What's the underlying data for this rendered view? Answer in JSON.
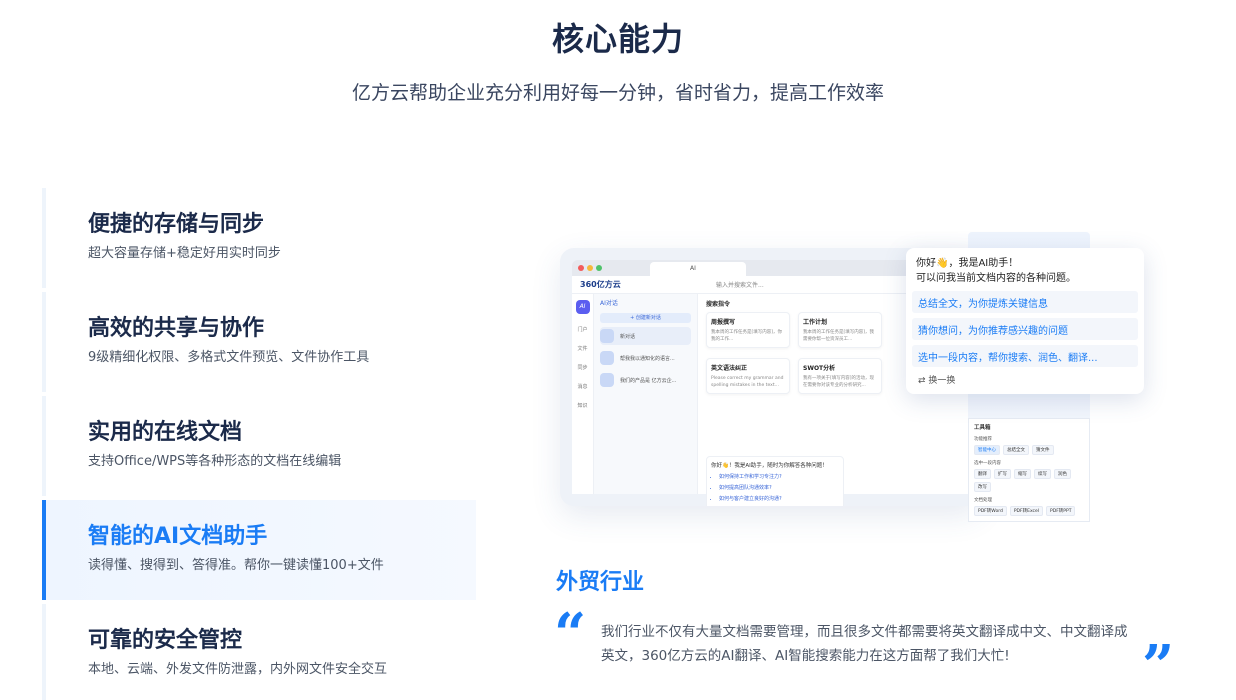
{
  "header": {
    "title": "核心能力",
    "subtitle": "亿方云帮助企业充分利用好每一分钟，省时省力，提高工作效率"
  },
  "features": [
    {
      "title": "便捷的存储与同步",
      "desc": "超大容量存储+稳定好用实时同步",
      "active": false
    },
    {
      "title": "高效的共享与协作",
      "desc": "9级精细化权限、多格式文件预览、文件协作工具",
      "active": false
    },
    {
      "title": "实用的在线文档",
      "desc": "支持Office/WPS等各种形态的文档在线编辑",
      "active": false
    },
    {
      "title": "智能的AI文档助手",
      "desc": "读得懂、搜得到、答得准。帮你一键读懂100+文件",
      "active": true
    },
    {
      "title": "可靠的安全管控",
      "desc": "本地、云端、外发文件防泄露，内外网文件安全交互",
      "active": false
    }
  ],
  "mockup": {
    "tab_label": "AI",
    "logo": "360亿方云",
    "search_placeholder": "输入并搜索文件...",
    "side_nav": [
      "门户",
      "文件",
      "同步",
      "消息",
      "知识"
    ],
    "ai_badge": "AI",
    "list_header": "AI对话",
    "new_chat": "+ 创建新对话",
    "chats": [
      "新对话",
      "帮我我以通知化的语言...",
      "我们的产品是 亿方云企..."
    ],
    "main_header": "搜索指令",
    "cards": [
      {
        "title": "周报撰写",
        "desc": "我本周的工作任务是[填写内容]，你我的工作..."
      },
      {
        "title": "工作计划",
        "desc": "我本周的工作任务是[填写内容]，我需要你帮一位资深员工..."
      },
      {
        "title": "英文语法纠正",
        "desc": "Please correct my grammar and spelling mistakes in the text..."
      },
      {
        "title": "SWOT分析",
        "desc": "我有一项关于[填写内容]的活动，现在需要你对该专业的分析研究..."
      }
    ],
    "chat_intro": "你好👋！我是AI助手，随时为你解答各种问题！",
    "chat_suggestions": [
      "如何保持工作和学习专注力?",
      "如何提高团队沟通效率?",
      "如何与客户建立良好的沟通?"
    ]
  },
  "popup": {
    "greeting_1": "你好👋，我是AI助手！",
    "greeting_2": "可以问我当前文档内容的各种问题。",
    "options": [
      "总结全文，为你提炼关键信息",
      "猜你想问，为你推荐感兴趣的问题",
      "选中一段内容，帮你搜索、润色、翻译..."
    ],
    "swap": "换一换"
  },
  "tools": {
    "title": "工具箱",
    "sections": [
      {
        "label": "功能推荐",
        "chips": [
          "智能中心",
          "总结全文",
          "猜文件"
        ]
      },
      {
        "label": "选中一段内容",
        "chips": [
          "翻译",
          "扩写",
          "缩写",
          "续写",
          "润色",
          "改写"
        ]
      },
      {
        "label": "文档处理",
        "chips": [
          "PDF转Word",
          "PDF转Excel",
          "PDF转PPT"
        ]
      }
    ]
  },
  "testimonial": {
    "industry": "外贸行业",
    "quote": "我们行业不仅有大量文档需要管理，而且很多文件都需要将英文翻译成中文、中文翻译成英文，360亿方云的AI翻译、AI智能搜索能力在这方面帮了我们大忙!",
    "quote_open": "“",
    "quote_close": "”"
  },
  "colors": {
    "accent": "#1a7cf5",
    "title": "#1b2a4a"
  }
}
